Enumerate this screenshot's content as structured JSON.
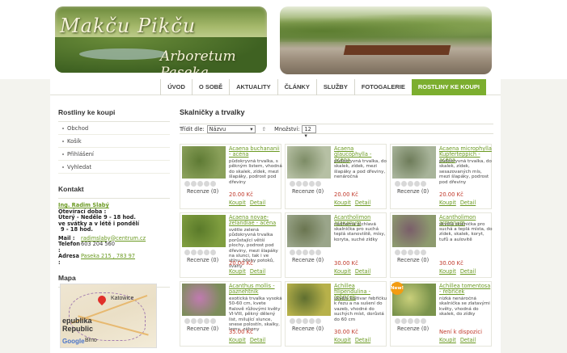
{
  "header": {
    "title_line1": "Makču Pikču",
    "title_line2": "Arboretum Paseka"
  },
  "nav": {
    "items": [
      "ÚVOD",
      "O SOBĚ",
      "AKTUALITY",
      "ČLÁNKY",
      "SLUŽBY",
      "FOTOGALERIE",
      "ROSTLINY KE KOUPI"
    ],
    "active_index": 6
  },
  "sidebar": {
    "shop_heading": "Rostliny ke koupi",
    "menu": [
      "Obchod",
      "Košík",
      "Přihlášení",
      "Vyhledat"
    ],
    "contact_heading": "Kontakt",
    "contact": {
      "name": "Ing. Radim Slabý",
      "hours_label": "Otevírací doba :",
      "hours_line1": "Úterý - Neděle 9 - 18 hod.",
      "hours_line2": "ve svátky a v létě i pondělí",
      "hours_line3": "9 - 18 hod.",
      "mail_label": "Mail :",
      "mail_value": "radimslaby@centrum.cz",
      "phone_label": "Telefon :",
      "phone_value": "603 204 560",
      "address_label": "Adresa :",
      "address_value": "Paseka 215 , 783 97"
    },
    "map_heading": "Mapa",
    "map_labels": [
      "Katowice",
      "epublika",
      "Republic",
      "Brno"
    ],
    "map_logo": "Google"
  },
  "content": {
    "heading": "Skalničky a trvalky",
    "sort_label": "Třídit dle:",
    "sort_value": "Názvu",
    "qty_label": "Množství:",
    "qty_value": "12"
  },
  "products": [
    {
      "title": "Acaena buchananii - acéna",
      "desc": "půdokryvná trvalka, s pěkným listem, vhodná do skalek, zídek, mezi šlapáky, podrost pod dřeviny",
      "price": "20.00 Kč",
      "reviews": "Recenze (0)",
      "buy": "Koupit",
      "detail": "Detail",
      "new": ""
    },
    {
      "title": "Acaena glaucophylla - acéna",
      "desc": "půdokryvná trvalka, do skalek, zídek, mezi šlapáky a pod dřeviny, nenáročná",
      "price": "20.00 Kč",
      "reviews": "Recenze (0)",
      "buy": "Koupit",
      "detail": "Detail",
      "new": ""
    },
    {
      "title": "Acaena microphylla Kupferteppich - acéna",
      "desc": "půdokryvná trvalka, do skalek, zídek, sesazovaných mís, mezi šlapáky, podrost pod dřeviny",
      "price": "20.00 Kč",
      "reviews": "Recenze (0)",
      "buy": "Koupit",
      "detail": "Detail",
      "new": ""
    },
    {
      "title": "Acaena novae-zelandiae - acéna",
      "desc": "světle zelená půdokryvná trvalka porůstající větší plochy, podrost pod dřeviny, mezi šlapáky na slunci, tak i ve stínu, břehy potoků, svahy",
      "price": "20.00 Kč",
      "reviews": "Recenze (0)",
      "buy": "Koupit",
      "detail": "Detail",
      "new": ""
    },
    {
      "title": "Acantholimon araxanum",
      "desc": "nádherná pichlavá skalnička pro suchá teplá stanoviště, mísy, koryta, suché zídky",
      "price": "30.00 Kč",
      "reviews": "Recenze (0)",
      "buy": "Koupit",
      "detail": "Detail",
      "new": ""
    },
    {
      "title": "Acantholimon armenum",
      "desc": "skvělá skalnička pro suchá a teplá místa, do zídek, skalek, koryt, tufů a aulovitě",
      "price": "30.00 Kč",
      "reviews": "Recenze (0)",
      "buy": "Koupit",
      "detail": "Detail",
      "new": ""
    },
    {
      "title": "Acanthus mollis - paznehtník",
      "desc": "exotická trvalka vysoká 50-60 cm, kvete fialově růžovými květy VI-VIII, pěkný dělený list, milující slunce, snese polostín, skalky, lemy, záhony",
      "price": "35.00 Kč",
      "reviews": "Recenze (0)",
      "buy": "Koupit",
      "detail": "Detail",
      "new": ""
    },
    {
      "title": "Achillea filipendulina - řebříček",
      "desc": "skvělý kultivar řebříčku k řezu a na sušení do vazeb, vhodné do suchých míst, dorůstá do 60 cm",
      "price": "30.00 Kč",
      "reviews": "Recenze (0)",
      "buy": "Koupit",
      "detail": "Detail",
      "new": ""
    },
    {
      "title": "Achillea tomentosa - řebříček",
      "desc": "nízká nenáročná skalnička se zlatavými květy, vhodná do skalek, do zídky",
      "price": "Není k dispozici",
      "reviews": "Recenze (0)",
      "buy": "Koupit",
      "detail": "Detail",
      "new": "New!"
    }
  ],
  "colors": {
    "accent_green": "#7cae2f",
    "link_green": "#6b9a22",
    "price_red": "#c0392b"
  }
}
